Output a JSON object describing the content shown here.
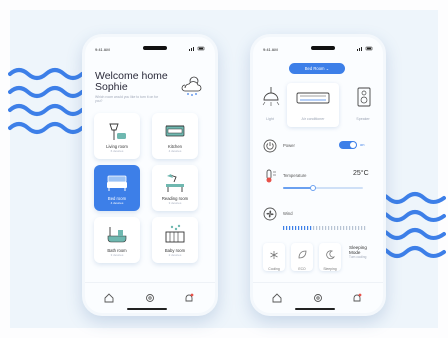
{
  "colors": {
    "accent": "#3d7fe8",
    "wave": "#3d7fe8",
    "panel": "#eef5fb"
  },
  "phone1": {
    "status": {
      "time": "9:41 AM"
    },
    "greeting_line1": "Welcome home",
    "greeting_line2": "Sophie",
    "subtitle": "Which room would you like to turn it on for you?",
    "weather_icon": "cloud-snow-icon",
    "rooms": [
      {
        "name": "Living room",
        "count": "6 devices",
        "icon": "lamp-sofa-icon"
      },
      {
        "name": "Kitchen",
        "count": "4 devices",
        "icon": "stove-icon"
      },
      {
        "name": "Bed room",
        "count": "4 devices",
        "icon": "bed-icon",
        "active": true
      },
      {
        "name": "Reading room",
        "count": "3 devices",
        "icon": "desk-lamp-icon"
      },
      {
        "name": "Bath room",
        "count": "3 devices",
        "icon": "bathtub-icon"
      },
      {
        "name": "Baby room",
        "count": "2 devices",
        "icon": "crib-icon"
      }
    ],
    "nav": [
      "home-icon",
      "settings-icon",
      "notification-icon"
    ]
  },
  "phone2": {
    "status": {
      "time": "9:41 AM"
    },
    "room_select": "Bed Room ⌄",
    "devices": [
      {
        "label": "Light",
        "icon": "ceiling-light-icon"
      },
      {
        "label": "Air conditioner",
        "icon": "air-conditioner-icon",
        "active": true
      },
      {
        "label": "Speaker",
        "icon": "speaker-icon"
      }
    ],
    "power_label": "Power",
    "power_state": "on",
    "temperature_label": "Temperature",
    "temperature_value": "25°C",
    "temperature_level": 0.38,
    "wind_label": "Wind",
    "modes": [
      {
        "label": "Cooling",
        "icon": "snowflake-icon"
      },
      {
        "label": "ECO",
        "icon": "leaf-icon"
      },
      {
        "label": "Sleeping",
        "icon": "moon-icon",
        "active": true
      }
    ],
    "sleep_mode_title_1": "Sleeping",
    "sleep_mode_title_2": "Mode",
    "sleep_mode_desc": "Turn cooling",
    "nav": [
      "home-icon",
      "settings-icon",
      "notification-icon"
    ]
  }
}
